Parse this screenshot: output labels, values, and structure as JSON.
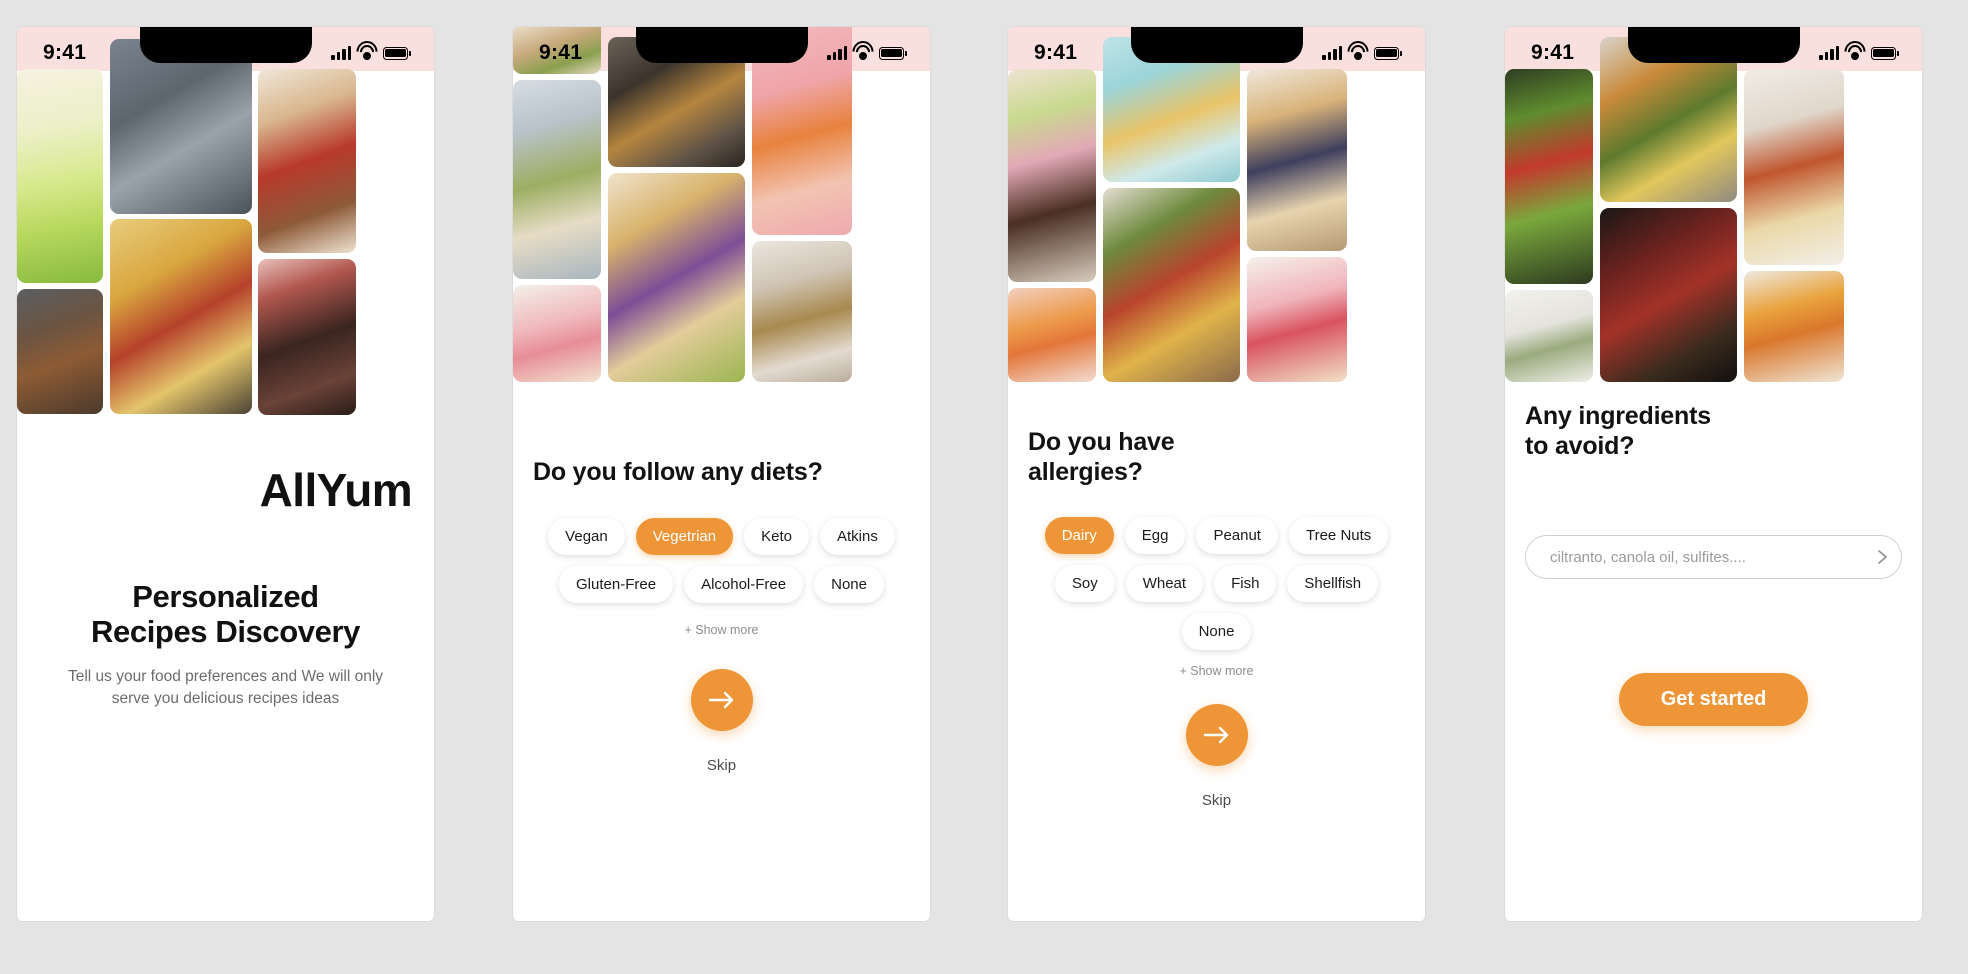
{
  "meta": {
    "accent": "#ee9637",
    "chip_bg": "#ffffff",
    "pink_bar": "#fadfdf",
    "canvas_bg": "#e4e4e4"
  },
  "status_bar": {
    "time": "9:41",
    "signal_icon": "cellular-signal-icon",
    "wifi_icon": "wifi-icon",
    "battery_icon": "battery-icon"
  },
  "screens": [
    {
      "id": "welcome",
      "brand": "AllYum",
      "hero_title_line1": "Personalized",
      "hero_title_line2": "Recipes Discovery",
      "hero_subtitle": "Tell us your food preferences and We will only serve you delicious recipes ideas"
    },
    {
      "id": "diets",
      "title": "Do you follow any diets?",
      "chips": [
        {
          "label": "Vegan",
          "selected": false
        },
        {
          "label": "Vegetrian",
          "selected": true
        },
        {
          "label": "Keto",
          "selected": false
        },
        {
          "label": "Atkins",
          "selected": false
        },
        {
          "label": "Gluten-Free",
          "selected": false
        },
        {
          "label": "Alcohol-Free",
          "selected": false
        },
        {
          "label": "None",
          "selected": false
        }
      ],
      "show_more": "+ Show more",
      "next_icon": "arrow-right-icon",
      "skip": "Skip"
    },
    {
      "id": "allergies",
      "title_line1": "Do you have",
      "title_line2": "allergies?",
      "chips": [
        {
          "label": "Dairy",
          "selected": true
        },
        {
          "label": "Egg",
          "selected": false
        },
        {
          "label": "Peanut",
          "selected": false
        },
        {
          "label": "Tree Nuts",
          "selected": false
        },
        {
          "label": "Soy",
          "selected": false
        },
        {
          "label": "Wheat",
          "selected": false
        },
        {
          "label": "Fish",
          "selected": false
        },
        {
          "label": "Shellfish",
          "selected": false
        },
        {
          "label": "None",
          "selected": false
        }
      ],
      "show_more": "+ Show more",
      "next_icon": "arrow-right-icon",
      "skip": "Skip"
    },
    {
      "id": "avoid",
      "title_line1": "Any ingredients",
      "title_line2": "to avoid?",
      "input_value": "",
      "input_placeholder": "ciltranto, canola oil, sulfites....",
      "submit_icon": "chevron-right-icon",
      "cta_label": "Get started"
    }
  ]
}
